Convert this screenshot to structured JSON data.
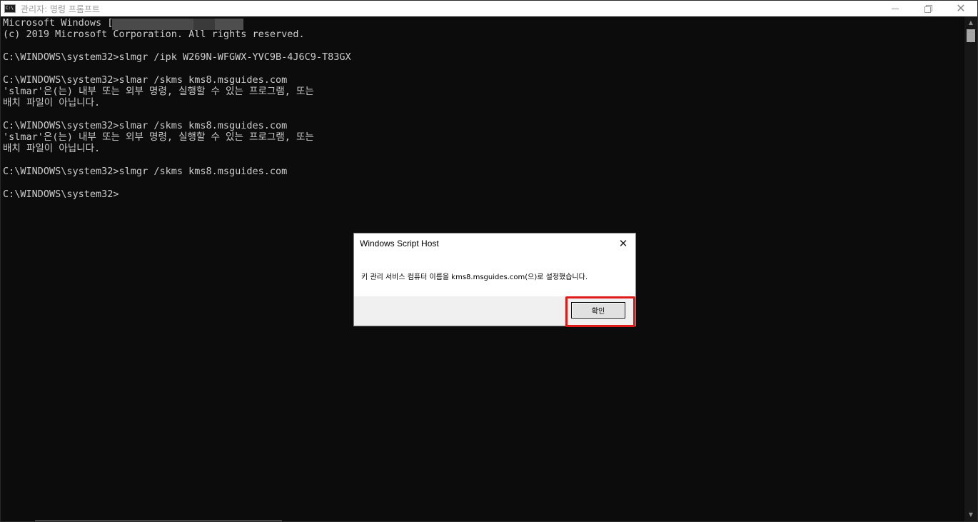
{
  "window": {
    "title": "관리자: 명령 프롬프트",
    "icon": "cmd-icon",
    "icon_text": "C:\\"
  },
  "console": {
    "lines": [
      "Microsoft Windows [",
      "(c) 2019 Microsoft Corporation. All rights reserved.",
      "",
      "C:\\WINDOWS\\system32>slmgr /ipk W269N-WFGWX-YVC9B-4J6C9-T83GX",
      "",
      "C:\\WINDOWS\\system32>slmar /skms kms8.msguides.com",
      "'slmar'은(는) 내부 또는 외부 명령, 실행할 수 있는 프로그램, 또는",
      "배치 파일이 아닙니다.",
      "",
      "C:\\WINDOWS\\system32>slmar /skms kms8.msguides.com",
      "'slmar'은(는) 내부 또는 외부 명령, 실행할 수 있는 프로그램, 또는",
      "배치 파일이 아닙니다.",
      "",
      "C:\\WINDOWS\\system32>slmgr /skms kms8.msguides.com",
      "",
      "C:\\WINDOWS\\system32>"
    ]
  },
  "dialog": {
    "title": "Windows Script Host",
    "message": "키 관리 서비스 컴퓨터 이름을 kms8.msguides.com(으)로 설정했습니다.",
    "ok_label": "확인",
    "close_glyph": "✕"
  },
  "colors": {
    "console_bg": "#0c0c0c",
    "console_text": "#cccccc",
    "highlight": "#e01919"
  }
}
